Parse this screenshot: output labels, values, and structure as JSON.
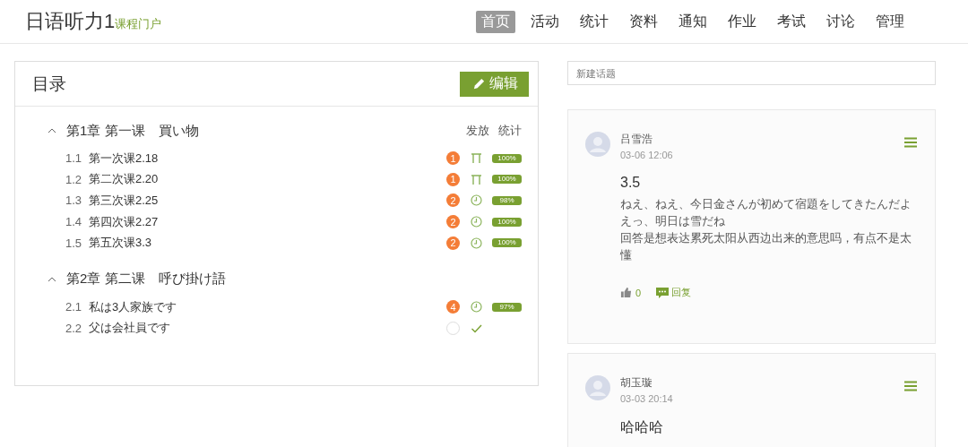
{
  "header": {
    "title": "日语听力1",
    "subtitle": "课程门户",
    "nav": [
      {
        "label": "首页",
        "selected": true
      },
      {
        "label": "活动",
        "selected": false
      },
      {
        "label": "统计",
        "selected": false
      },
      {
        "label": "资料",
        "selected": false
      },
      {
        "label": "通知",
        "selected": false
      },
      {
        "label": "作业",
        "selected": false
      },
      {
        "label": "考试",
        "selected": false
      },
      {
        "label": "讨论",
        "selected": false
      },
      {
        "label": "管理",
        "selected": false
      }
    ]
  },
  "catalog": {
    "title": "目录",
    "edit_button": "编辑",
    "columns": [
      "发放",
      "统计"
    ],
    "chapters": [
      {
        "title": "第1章 第一课　買い物",
        "expanded": true,
        "children": [
          {
            "number": "1.1",
            "title": "第一次课2.18",
            "count": "1",
            "kind": "task",
            "percent": "100%"
          },
          {
            "number": "1.2",
            "title": "第二次课2.20",
            "count": "1",
            "kind": "task",
            "percent": "100%"
          },
          {
            "number": "1.3",
            "title": "第三次课2.25",
            "count": "2",
            "kind": "clock",
            "percent": "98%"
          },
          {
            "number": "1.4",
            "title": "第四次课2.27",
            "count": "2",
            "kind": "clock",
            "percent": "100%"
          },
          {
            "number": "1.5",
            "title": "第五次课3.3",
            "count": "2",
            "kind": "clock",
            "percent": "100%"
          }
        ]
      },
      {
        "title": "第2章 第二课　呼び掛け語",
        "expanded": true,
        "children": [
          {
            "number": "2.1",
            "title": "私は3人家族です",
            "count": "4",
            "kind": "clock",
            "percent": "97%"
          },
          {
            "number": "2.2",
            "title": "父は会社員です",
            "kind": "check"
          }
        ]
      }
    ]
  },
  "discussion": {
    "new_topic_placeholder": "新建话题",
    "posts": [
      {
        "author": "吕雪浩",
        "time": "03-06 12:06",
        "title": "3.5",
        "lines": [
          "ねえ、ねえ、今日金さんが初めて宿題をしてきたんだよ",
          "えっ、明日は雪だね",
          "回答是想表达累死太阳从西边出来的意思吗，有点不是太懂"
        ],
        "likes": "0",
        "reply": "回复"
      },
      {
        "author": "胡玉璇",
        "time": "03-03 20:14",
        "title": "哈哈哈"
      }
    ]
  }
}
